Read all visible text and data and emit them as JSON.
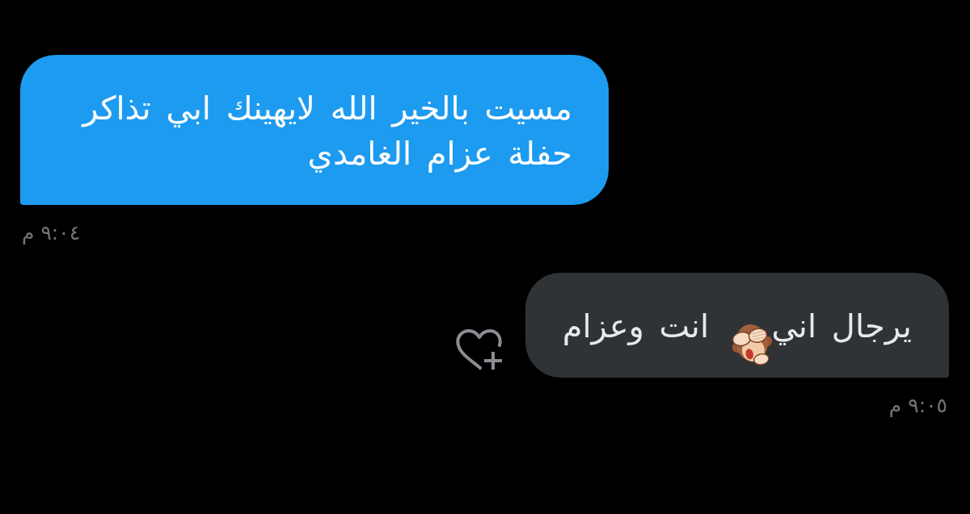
{
  "messages": [
    {
      "kind": "sent",
      "text": "مسيت بالخير الله لايهينك ابي تذاكر حفلة عزام الغامدي",
      "time": "٩:٠٤ م",
      "covered_by_sticker": false
    },
    {
      "kind": "received",
      "text": "يرجال اني   انت وعزام",
      "time": "٩:٠٥ م",
      "covered_by_sticker": true
    }
  ]
}
